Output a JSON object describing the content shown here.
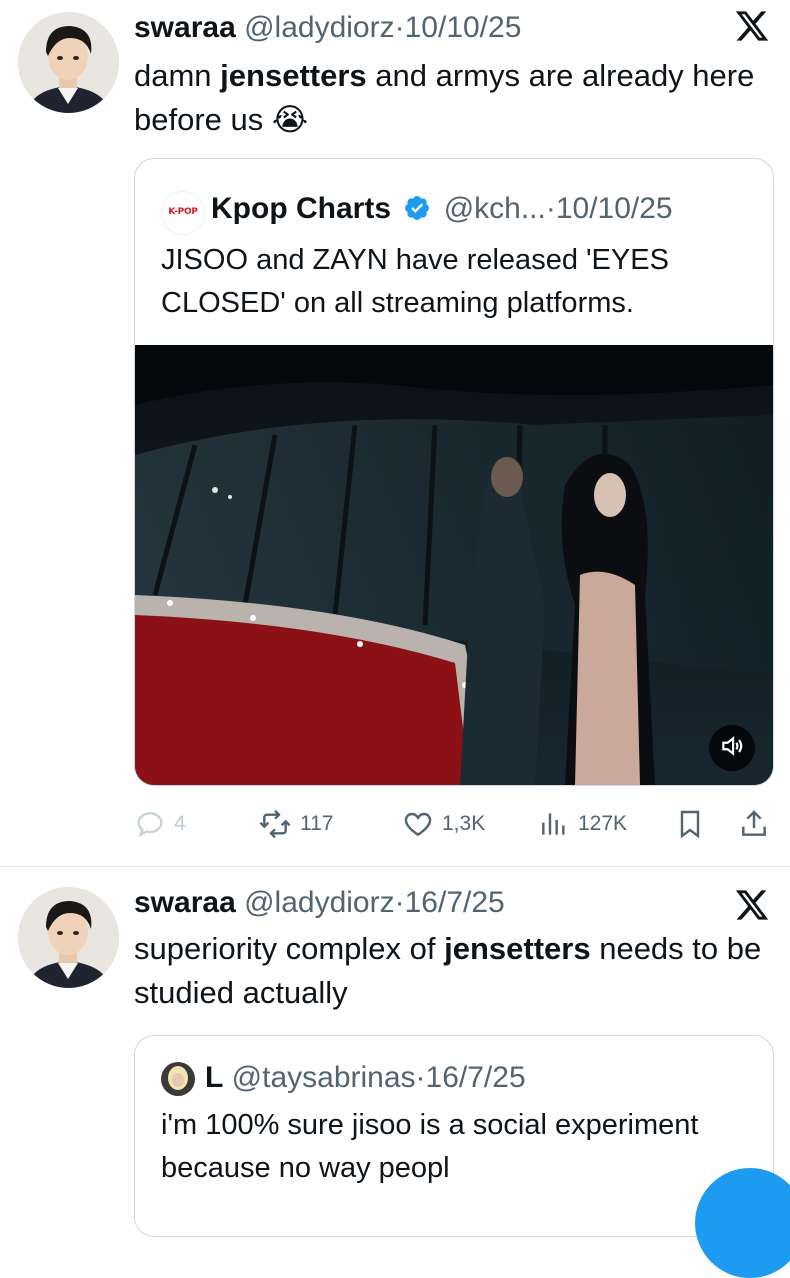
{
  "tweets": [
    {
      "author_name": "swaraa",
      "handle": "@ladydiorz",
      "separator": "·",
      "date": "10/10/25",
      "text_1": "damn ",
      "text_bold": "jensetters",
      "text_2": " and armys are already here before us ",
      "emoji": "😭",
      "quote": {
        "avatar_label": "K-POP",
        "author_name": "Kpop Charts",
        "handle": "@kch...",
        "separator": "·",
        "date": "10/10/25",
        "text": "JISOO and ZAYN have released 'EYES CLOSED' on all streaming platforms."
      },
      "actions": {
        "replies": "4",
        "reposts": "117",
        "likes": "1,3K",
        "views": "127K"
      }
    },
    {
      "author_name": "swaraa",
      "handle": "@ladydiorz",
      "separator": "·",
      "date": "16/7/25",
      "text_1": "superiority complex of ",
      "text_bold": "jensetters",
      "text_2": " needs to be studied actually",
      "quote": {
        "author_name": "L",
        "handle": "@taysabrinas",
        "separator": "·",
        "date": "16/7/25",
        "text": "i'm 100% sure jisoo is a social experiment because no way peopl"
      }
    }
  ],
  "colors": {
    "text": "#0f1419",
    "secondary": "#536471",
    "verified": "#1d9bf0",
    "border": "#cfd9de"
  },
  "icons": [
    "x-logo-icon",
    "verified-badge-icon",
    "reply-icon",
    "repost-icon",
    "like-icon",
    "views-icon",
    "bookmark-icon",
    "share-icon",
    "volume-icon"
  ]
}
